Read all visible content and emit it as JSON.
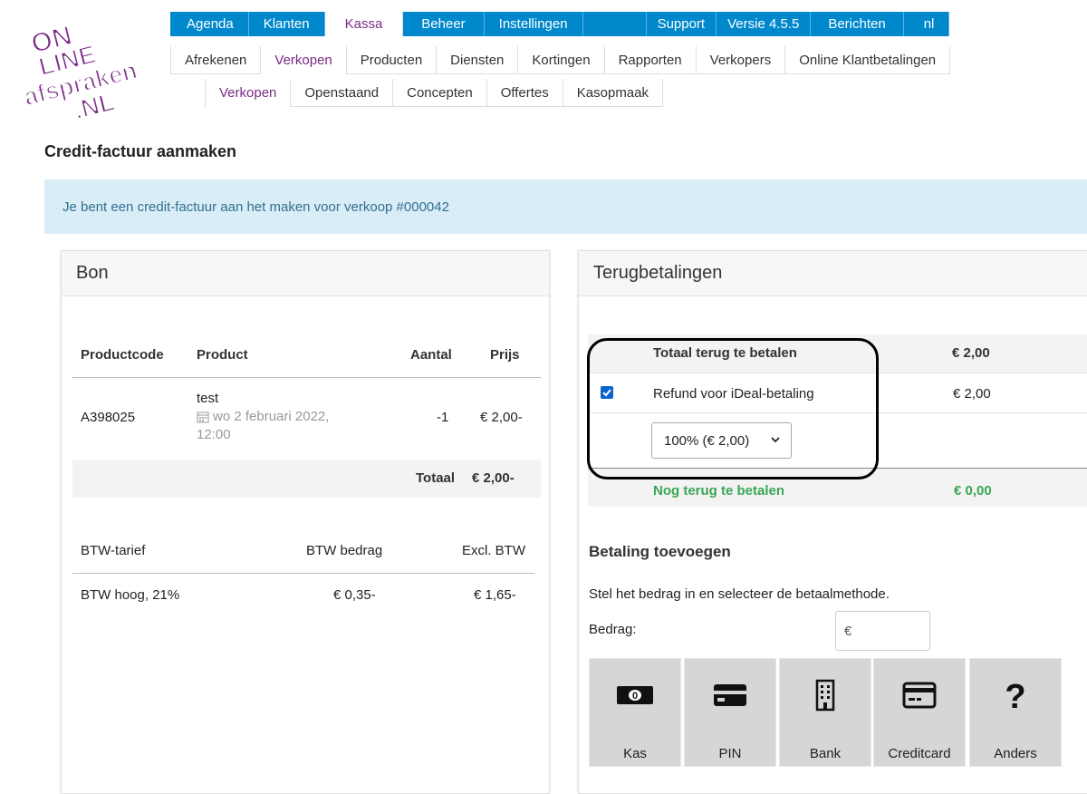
{
  "logo": {
    "line1": "ON",
    "line2": "LINE",
    "line3": "afspraken",
    "line4": ".NL"
  },
  "nav_main": [
    {
      "label": "Agenda"
    },
    {
      "label": "Klanten"
    },
    {
      "label": "Kassa"
    },
    {
      "label": "Beheer"
    },
    {
      "label": "Instellingen"
    },
    {
      "label": "Support"
    },
    {
      "label": "Versie 4.5.5"
    },
    {
      "label": "Berichten"
    },
    {
      "label": "nl"
    }
  ],
  "nav_sub": [
    {
      "label": "Afrekenen"
    },
    {
      "label": "Verkopen"
    },
    {
      "label": "Producten"
    },
    {
      "label": "Diensten"
    },
    {
      "label": "Kortingen"
    },
    {
      "label": "Rapporten"
    },
    {
      "label": "Verkopers"
    },
    {
      "label": "Online Klantbetalingen"
    }
  ],
  "nav_sub2": [
    {
      "label": "Verkopen"
    },
    {
      "label": "Openstaand"
    },
    {
      "label": "Concepten"
    },
    {
      "label": "Offertes"
    },
    {
      "label": "Kasopmaak"
    }
  ],
  "page_title": "Credit-factuur aanmaken",
  "info_message": "Je bent een credit-factuur aan het maken voor verkoop #000042",
  "bon": {
    "title": "Bon",
    "headers": {
      "code": "Productcode",
      "product": "Product",
      "aantal": "Aantal",
      "prijs": "Prijs"
    },
    "row": {
      "code": "A398025",
      "product": "test",
      "date": "wo 2 februari 2022,",
      "time": "12:00",
      "aantal": "-1",
      "prijs": "€ 2,00-"
    },
    "totaal_label": "Totaal",
    "totaal_value": "€ 2,00-",
    "btw_headers": {
      "tarief": "BTW-tarief",
      "bedrag": "BTW bedrag",
      "excl": "Excl. BTW"
    },
    "btw_row": {
      "tarief": "BTW hoog, 21%",
      "bedrag": "€ 0,35-",
      "excl": "€ 1,65-"
    }
  },
  "terug": {
    "title": "Terugbetalingen",
    "totaal_label": "Totaal terug te betalen",
    "totaal_value": "€ 2,00",
    "refund_label": "Refund voor iDeal-betaling",
    "refund_value": "€ 2,00",
    "select_value": "100% (€ 2,00)",
    "nog_label": "Nog terug te betalen",
    "nog_value": "€ 0,00",
    "betaling_title": "Betaling toevoegen",
    "betaling_desc": "Stel het bedrag in en selecteer de betaalmethode.",
    "bedrag_label": "Bedrag:",
    "bedrag_placeholder": "€",
    "methods": [
      {
        "label": "Kas"
      },
      {
        "label": "PIN"
      },
      {
        "label": "Bank"
      },
      {
        "label": "Creditcard"
      },
      {
        "label": "Anders"
      }
    ]
  },
  "colors": {
    "nav_blue": "#0088cc",
    "active_purple": "#7b2a87",
    "info_bg": "#d9edf7",
    "green": "#3aa655"
  }
}
